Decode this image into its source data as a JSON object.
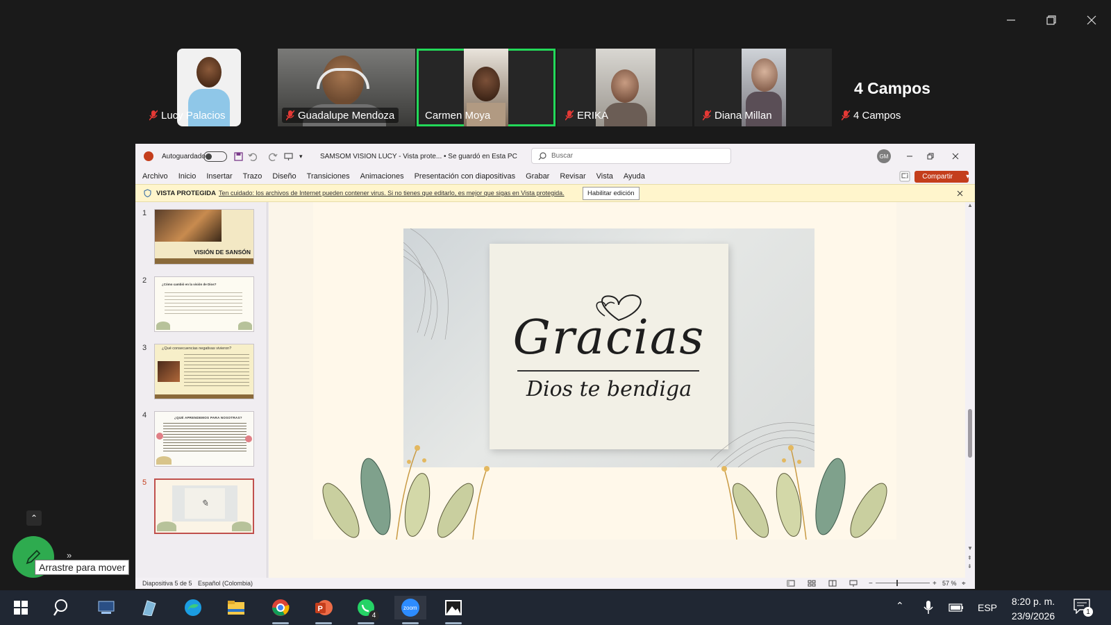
{
  "zoom": {
    "participants": [
      {
        "name": "Lucy Palacios"
      },
      {
        "name": "Guadalupe Mendoza"
      },
      {
        "name": "Carmen Moya"
      },
      {
        "name": "ERIKA"
      },
      {
        "name": "Diana Millan"
      },
      {
        "name": "4 Campos"
      }
    ],
    "big_name": "4 Campos",
    "drag_tooltip": "Arrastre para mover",
    "accent_green": "#23d959"
  },
  "ppt": {
    "autosave_label": "Autoguardado",
    "doc_title": "SAMSOM VISION LUCY  -  Vista prote...  •  Se guardó en Esta PC",
    "search_placeholder": "Buscar",
    "user_initials": "GM",
    "menu": [
      "Archivo",
      "Inicio",
      "Insertar",
      "Trazo",
      "Diseño",
      "Transiciones",
      "Animaciones",
      "Presentación con diapositivas",
      "Grabar",
      "Revisar",
      "Vista",
      "Ayuda"
    ],
    "share_label": "Compartir",
    "protected": {
      "title": "VISTA PROTEGIDA",
      "message": "Ten cuidado: los archivos de Internet pueden contener virus. Si no tienes que editarlo, es mejor que sigas en Vista protegida.",
      "enable_button": "Habilitar edición"
    },
    "thumbnails": [
      {
        "num": "1",
        "text": "VISIÓN DE SANSÓN"
      },
      {
        "num": "2",
        "text": "¿Cómo cambió en la visión de Dios?"
      },
      {
        "num": "3",
        "text": "¿Qué consecuencias negativas vivieron?"
      },
      {
        "num": "4",
        "text": "¿QUÉ APRENDEMOS PARA NOSOTRAS?"
      },
      {
        "num": "5",
        "text": ""
      }
    ],
    "slide": {
      "title": "Gracias",
      "subtitle": "Dios te bendiga"
    },
    "status": {
      "slide_count": "Diapositiva 5 de 5",
      "language": "Español (Colombia)",
      "zoom": "57 %"
    },
    "brand_red": "#c43e1c"
  },
  "taskbar": {
    "language": "ESP",
    "time": "8:20 p. m.",
    "date": "23/9/2026",
    "whatsapp_badge": "4",
    "notif_badge": "1"
  }
}
